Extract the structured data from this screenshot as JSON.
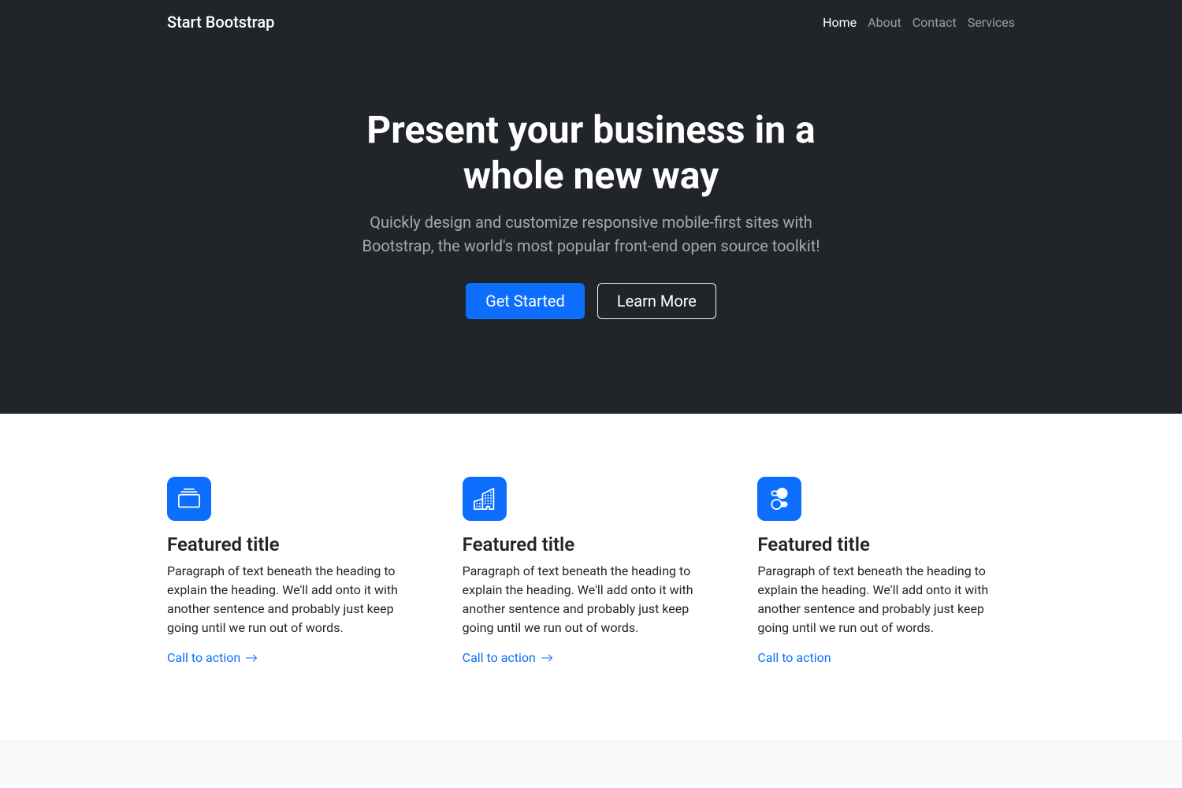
{
  "nav": {
    "brand": "Start Bootstrap",
    "items": [
      {
        "label": "Home",
        "active": true
      },
      {
        "label": "About",
        "active": false
      },
      {
        "label": "Contact",
        "active": false
      },
      {
        "label": "Services",
        "active": false
      }
    ]
  },
  "hero": {
    "title": "Present your business in a whole new way",
    "lead": "Quickly design and customize responsive mobile-first sites with Bootstrap, the world's most popular front-end open source toolkit!",
    "primary_button": "Get Started",
    "secondary_button": "Learn More"
  },
  "features": [
    {
      "icon": "collection-icon",
      "title": "Featured title",
      "text": "Paragraph of text beneath the heading to explain the heading. We'll add onto it with another sentence and probably just keep going until we run out of words.",
      "cta": "Call to action",
      "show_arrow": true
    },
    {
      "icon": "building-icon",
      "title": "Featured title",
      "text": "Paragraph of text beneath the heading to explain the heading. We'll add onto it with another sentence and probably just keep going until we run out of words.",
      "cta": "Call to action",
      "show_arrow": true
    },
    {
      "icon": "toggles-icon",
      "title": "Featured title",
      "text": "Paragraph of text beneath the heading to explain the heading. We'll add onto it with another sentence and probably just keep going until we run out of words.",
      "cta": "Call to action",
      "show_arrow": false
    }
  ]
}
